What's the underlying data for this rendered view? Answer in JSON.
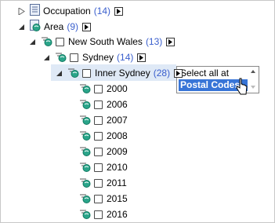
{
  "tree": {
    "occupation": {
      "label": "Occupation",
      "count": "(14)"
    },
    "area": {
      "label": "Area",
      "count": "(9)"
    },
    "nsw": {
      "label": "New South Wales",
      "count": "(13)"
    },
    "sydney": {
      "label": "Sydney",
      "count": "(14)"
    },
    "inner_sydney": {
      "label": "Inner Sydney",
      "count": "(28)"
    },
    "years": [
      "2000",
      "2006",
      "2007",
      "2008",
      "2009",
      "2010",
      "2011",
      "2015",
      "2016"
    ]
  },
  "popup": {
    "options": [
      "Select all at level",
      "Postal Codes"
    ],
    "selected_index": 1
  },
  "colors": {
    "count_text": "#3a5fcd",
    "highlight_row": "#dfe9f6",
    "selected_option": "#3875d7",
    "icon_teal": "#2aa58a"
  },
  "icons": {
    "collapsed": "triangle-right-icon",
    "expanded": "triangle-down-icon",
    "dimension": "document-list-icon",
    "hierarchy": "hierarchy-globe-icon",
    "menu": "menu-arrow-icon"
  }
}
